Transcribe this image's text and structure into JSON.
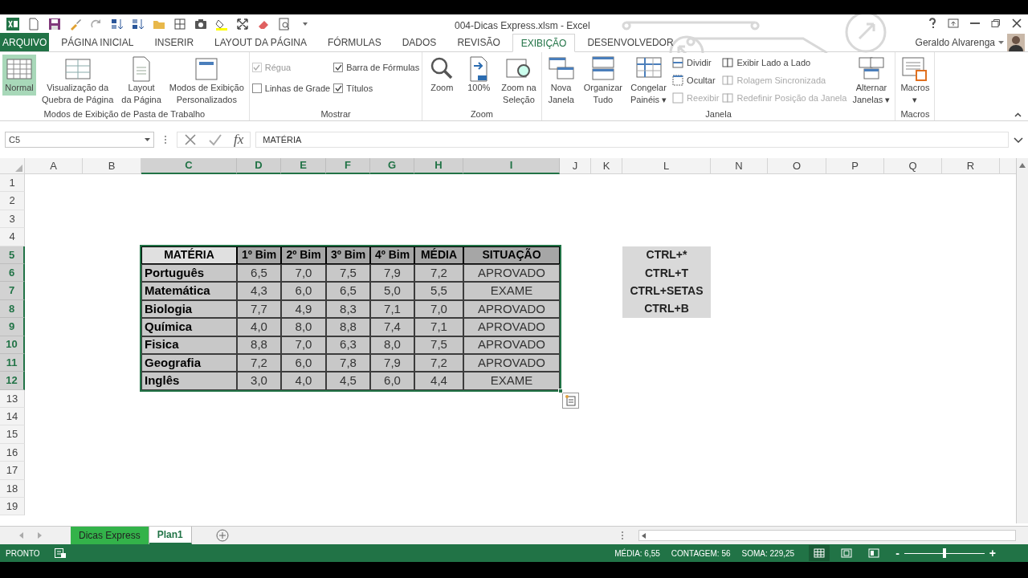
{
  "window": {
    "title": "004-Dicas Express.xlsm - Excel",
    "user": "Geraldo Alvarenga"
  },
  "tabs": [
    {
      "label": "ARQUIVO",
      "selected": false
    },
    {
      "label": "PÁGINA INICIAL",
      "selected": false
    },
    {
      "label": "INSERIR",
      "selected": false
    },
    {
      "label": "LAYOUT DA PÁGINA",
      "selected": false
    },
    {
      "label": "FÓRMULAS",
      "selected": false
    },
    {
      "label": "DADOS",
      "selected": false
    },
    {
      "label": "REVISÃO",
      "selected": false
    },
    {
      "label": "EXIBIÇÃO",
      "selected": true
    },
    {
      "label": "DESENVOLVEDOR",
      "selected": false
    }
  ],
  "ribbon": [
    {
      "name": "Modos de Exibição de Pasta de Trabalho",
      "columns": [
        [
          {
            "kind": "large",
            "label": "Normal",
            "selected": true
          }
        ],
        [
          {
            "kind": "large",
            "label": "Visualização da\nQuebra de Página",
            "selected": false
          }
        ],
        [
          {
            "kind": "large",
            "label": "Layout\nda Página",
            "selected": false
          }
        ],
        [
          {
            "kind": "large",
            "label": "Modos de Exibição\nPersonalizados",
            "selected": false
          }
        ]
      ]
    },
    {
      "name": "Mostrar",
      "columns": [
        [
          {
            "kind": "check",
            "label": "Régua",
            "checked": true,
            "disabled": true
          },
          {
            "kind": "check",
            "label": "Linhas de Grade",
            "checked": false,
            "disabled": false
          }
        ],
        [
          {
            "kind": "check",
            "label": "Barra de Fórmulas",
            "checked": true,
            "disabled": false
          },
          {
            "kind": "check",
            "label": "Títulos",
            "checked": true,
            "disabled": false
          }
        ]
      ]
    },
    {
      "name": "Zoom",
      "columns": [
        [
          {
            "kind": "large",
            "label": "Zoom",
            "selected": false
          }
        ],
        [
          {
            "kind": "large",
            "label": "100%",
            "selected": false
          }
        ],
        [
          {
            "kind": "large",
            "label": "Zoom na\nSeleção",
            "selected": false
          }
        ]
      ]
    },
    {
      "name": "Janela",
      "columns": [
        [
          {
            "kind": "large",
            "label": "Nova\nJanela",
            "selected": false
          }
        ],
        [
          {
            "kind": "large",
            "label": "Organizar\nTudo",
            "selected": false
          }
        ],
        [
          {
            "kind": "large",
            "label": "Congelar\nPainéis ▾",
            "selected": false
          }
        ],
        [
          {
            "kind": "small",
            "label": "Dividir",
            "disabled": false
          },
          {
            "kind": "small",
            "label": "Ocultar",
            "disabled": false
          },
          {
            "kind": "small",
            "label": "Reexibir",
            "disabled": true
          }
        ],
        [
          {
            "kind": "small",
            "label": "Exibir Lado a Lado",
            "disabled": false
          },
          {
            "kind": "small",
            "label": "Rolagem Sincronizada",
            "disabled": true
          },
          {
            "kind": "small",
            "label": "Redefinir Posição da Janela",
            "disabled": true
          }
        ],
        [
          {
            "kind": "large",
            "label": "Alternar\nJanelas ▾",
            "selected": false
          }
        ]
      ]
    },
    {
      "name": "Macros",
      "columns": [
        [
          {
            "kind": "large",
            "label": "Macros\n▾",
            "selected": false
          }
        ]
      ]
    }
  ],
  "formula_bar": {
    "name_box": "C5",
    "function_label": "fx",
    "value": "MATÉRIA"
  },
  "columns": [
    {
      "label": "A",
      "selected": false
    },
    {
      "label": "B",
      "selected": false
    },
    {
      "label": "C",
      "selected": true
    },
    {
      "label": "D",
      "selected": true
    },
    {
      "label": "E",
      "selected": true
    },
    {
      "label": "F",
      "selected": true
    },
    {
      "label": "G",
      "selected": true
    },
    {
      "label": "H",
      "selected": true
    },
    {
      "label": "I",
      "selected": true
    },
    {
      "label": "J",
      "selected": false
    },
    {
      "label": "K",
      "selected": false
    },
    {
      "label": "L",
      "selected": false
    },
    {
      "label": "N",
      "selected": false
    },
    {
      "label": "O",
      "selected": false
    },
    {
      "label": "P",
      "selected": false
    },
    {
      "label": "Q",
      "selected": false
    },
    {
      "label": "R",
      "selected": false
    }
  ],
  "rows": [
    {
      "label": "1",
      "selected": false
    },
    {
      "label": "2",
      "selected": false
    },
    {
      "label": "3",
      "selected": false
    },
    {
      "label": "4",
      "selected": false
    },
    {
      "label": "5",
      "selected": true
    },
    {
      "label": "6",
      "selected": true
    },
    {
      "label": "7",
      "selected": true
    },
    {
      "label": "8",
      "selected": true
    },
    {
      "label": "9",
      "selected": true
    },
    {
      "label": "10",
      "selected": true
    },
    {
      "label": "11",
      "selected": true
    },
    {
      "label": "12",
      "selected": true
    },
    {
      "label": "13",
      "selected": false
    },
    {
      "label": "14",
      "selected": false
    },
    {
      "label": "15",
      "selected": false
    },
    {
      "label": "16",
      "selected": false
    },
    {
      "label": "17",
      "selected": false
    },
    {
      "label": "18",
      "selected": false
    },
    {
      "label": "19",
      "selected": false
    }
  ],
  "table": {
    "header": [
      {
        "text": "MATÉRIA",
        "selected": true
      },
      {
        "text": "1º Bim",
        "selected": false
      },
      {
        "text": "2º Bim",
        "selected": false
      },
      {
        "text": "3º Bim",
        "selected": false
      },
      {
        "text": "4º Bim",
        "selected": false
      },
      {
        "text": "MÉDIA",
        "selected": false
      },
      {
        "text": "SITUAÇÃO",
        "selected": false
      }
    ],
    "rows": [
      [
        "Português",
        "6,5",
        "7,0",
        "7,5",
        "7,9",
        "7,2",
        "APROVADO"
      ],
      [
        "Matemática",
        "4,3",
        "6,0",
        "6,5",
        "5,0",
        "5,5",
        "EXAME"
      ],
      [
        "Biologia",
        "7,7",
        "4,9",
        "8,3",
        "7,1",
        "7,0",
        "APROVADO"
      ],
      [
        "Química",
        "4,0",
        "8,0",
        "8,8",
        "7,4",
        "7,1",
        "APROVADO"
      ],
      [
        "Fisica",
        "8,8",
        "7,0",
        "6,3",
        "8,0",
        "7,5",
        "APROVADO"
      ],
      [
        "Geografia",
        "7,2",
        "6,0",
        "7,8",
        "7,9",
        "7,2",
        "APROVADO"
      ],
      [
        "Inglês",
        "3,0",
        "4,0",
        "4,5",
        "6,0",
        "4,4",
        "EXAME"
      ]
    ]
  },
  "shortcuts": [
    "CTRL+*",
    "CTRL+T",
    "CTRL+SETAS",
    "CTRL+B"
  ],
  "sheet_tabs": [
    {
      "label": "Dicas Express",
      "color": "#33b34a",
      "selected": false
    },
    {
      "label": "Plan1",
      "selected": true
    }
  ],
  "status_bar": {
    "mode": "PRONTO",
    "stats": [
      "MÉDIA: 6,55",
      "CONTAGEM: 56",
      "SOMA: 229,25"
    ],
    "views": [
      {
        "kind": "normal",
        "selected": true
      },
      {
        "kind": "page",
        "selected": false
      },
      {
        "kind": "break",
        "selected": false
      }
    ],
    "zoom": {
      "minus": "-",
      "plus": "+",
      "level": 0.5
    }
  }
}
